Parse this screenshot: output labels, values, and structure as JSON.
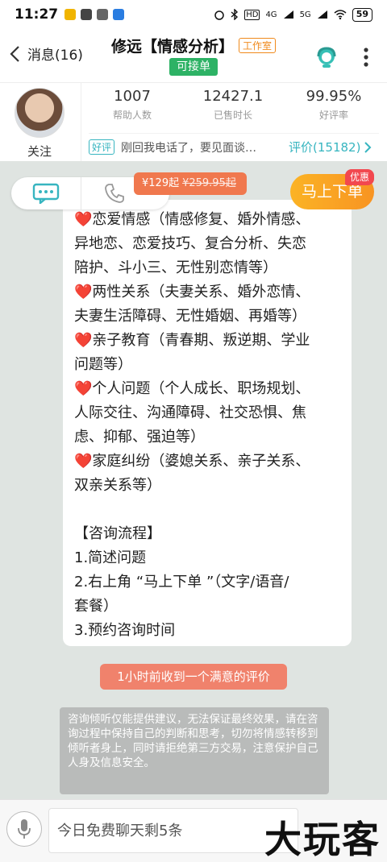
{
  "status_bar": {
    "time": "11:27",
    "battery": "59",
    "network_1": "HD",
    "network_2": "4G",
    "network_3": "5G"
  },
  "header": {
    "back_label": "消息(16)",
    "title": "修远【情感分析】",
    "studio_badge": "工作室",
    "accept_badge": "可接单"
  },
  "profile": {
    "follow_label": "关注",
    "stats": [
      {
        "value": "1007",
        "label": "帮助人数"
      },
      {
        "value": "12427.1",
        "label": "已售时长"
      },
      {
        "value": "99.95%",
        "label": "好评率"
      }
    ],
    "review_tag": "好评",
    "review_text": "刚回我电话了，要见面谈…",
    "review_count": "评价(15182)"
  },
  "actions": {
    "price_new": "¥129起",
    "price_old": "¥259.95起",
    "order_label": "马上下单",
    "promo_badge": "优惠"
  },
  "message": {
    "lines": [
      "❤️恋爱情感（情感修复、婚外情感、",
      "异地恋、恋爱技巧、复合分析、失恋",
      "陪护、斗小三、无性别恋情等）",
      "❤️两性关系（夫妻关系、婚外恋情、",
      "夫妻生活障碍、无性婚姻、再婚等）",
      "❤️亲子教育（青春期、叛逆期、学业",
      "问题等）",
      "❤️个人问题（个人成长、职场规划、",
      "人际交往、沟通障碍、社交恐惧、焦",
      "虑、抑郁、强迫等）",
      "❤️家庭纠纷（婆媳关系、亲子关系、",
      "双亲关系等）",
      "",
      "【咨询流程】",
      "1.简述问题",
      "2.右上角 “马上下单 ”（文字/语音/",
      "套餐）",
      "3.预约咨询时间"
    ]
  },
  "system_pill": "1小时前收到一个满意的评价",
  "notice": "咨询倾听仅能提供建议，无法保证最终效果，请在咨询过程中保持自己的判断和思考，切勿将情感转移到倾听者身上，同时请拒绝第三方交易，注意保护自己人身及信息安全。",
  "input": {
    "placeholder": "今日免费聊天剩5条"
  },
  "watermark": "大玩客",
  "colors": {
    "accent_teal": "#37b5c0",
    "order_orange": "#f89422",
    "accept_green": "#2db265",
    "price_coral": "#f0784e"
  },
  "icons": [
    "back-chevron-icon",
    "customer-service-icon",
    "more-vertical-icon",
    "chat-bubble-icon",
    "phone-icon",
    "microphone-icon",
    "chevron-right-icon"
  ]
}
